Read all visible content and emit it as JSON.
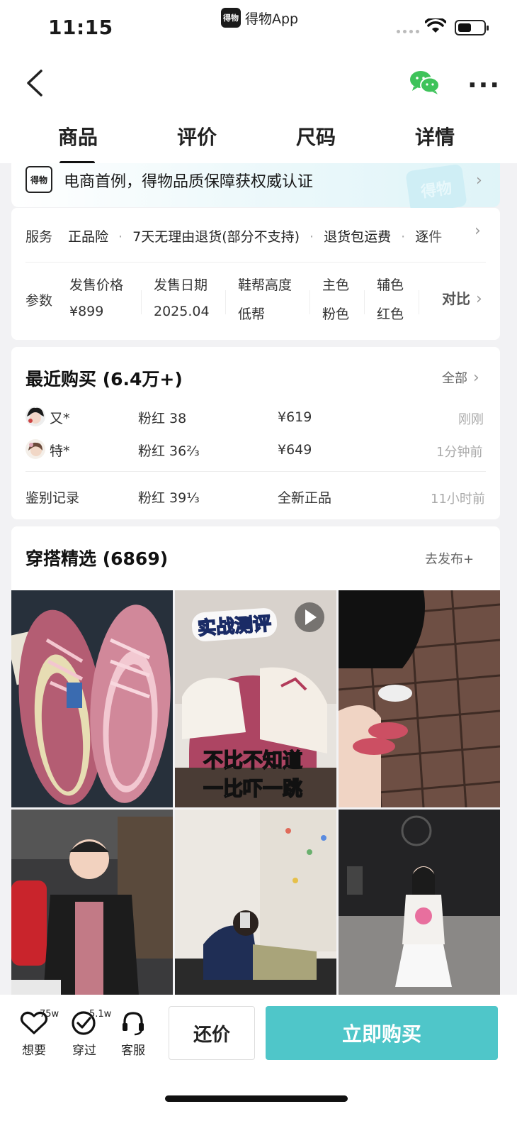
{
  "status_bar": {
    "time": "11:15",
    "app_name": "得物App",
    "app_logo_text": "得物"
  },
  "tabs": [
    {
      "label": "商品",
      "active": true
    },
    {
      "label": "评价",
      "active": false
    },
    {
      "label": "尺码",
      "active": false
    },
    {
      "label": "详情",
      "active": false
    }
  ],
  "banner": {
    "logo_text": "得物",
    "text": "电商首例，得物品质保障获权威认证",
    "watermark": "得物"
  },
  "service": {
    "label": "服务",
    "items": [
      "正品险",
      "7天无理由退货(部分不支持)",
      "退货包运费",
      "逐件"
    ]
  },
  "params": {
    "label": "参数",
    "items": [
      {
        "key": "发售价格",
        "value": "¥899"
      },
      {
        "key": "发售日期",
        "value": "2025.04"
      },
      {
        "key": "鞋帮高度",
        "value": "低帮"
      },
      {
        "key": "主色",
        "value": "粉色"
      },
      {
        "key": "辅色",
        "value": "红色"
      }
    ],
    "compare": "对比"
  },
  "recent": {
    "title": "最近购买 (6.4万+)",
    "all": "全部",
    "rows": [
      {
        "user": "又*",
        "spec": "粉红 38",
        "price": "¥619",
        "time": "刚刚"
      },
      {
        "user": "特*",
        "spec": "粉红 36⅔",
        "price": "¥649",
        "time": "1分钟前"
      }
    ],
    "auth": {
      "label": "鉴别记录",
      "spec": "粉红 39⅓",
      "status": "全新正品",
      "time": "11小时前"
    }
  },
  "outfits": {
    "title": "穿搭精选 (6869)",
    "publish": "去发布+",
    "review_tag": "实战测评",
    "review_caption_1": "不比不知道",
    "review_caption_2": "一比吓一跳"
  },
  "bottom": {
    "want": {
      "label": "想要",
      "count": "75w"
    },
    "worn": {
      "label": "穿过",
      "count": "5.1w"
    },
    "service": {
      "label": "客服"
    },
    "bargain": "还价",
    "buy": "立即购买"
  },
  "colors": {
    "accent": "#4fc6c9",
    "text": "#1a1a1a"
  }
}
